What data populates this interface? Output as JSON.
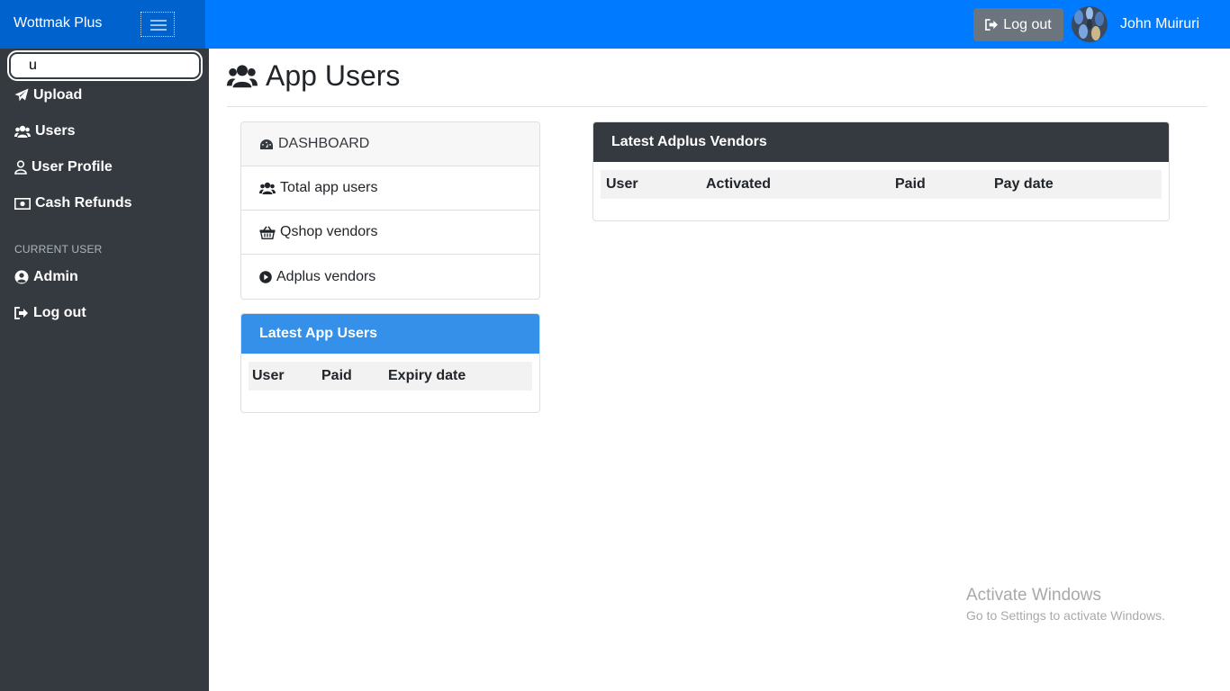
{
  "brand": {
    "name": "Wottmak Plus"
  },
  "search": {
    "value": "u"
  },
  "sidebar": {
    "items": [
      {
        "label": "Upload",
        "icon": "paper-plane-icon"
      },
      {
        "label": "Users",
        "icon": "users-icon"
      },
      {
        "label": "User Profile",
        "icon": "user-icon"
      },
      {
        "label": "Cash Refunds",
        "icon": "money-bill-icon"
      }
    ],
    "section_heading": "CURRENT USER",
    "current_user": {
      "label": "Admin",
      "icon": "user-circle-icon"
    },
    "logout": {
      "label": "Log out",
      "icon": "sign-out-icon"
    }
  },
  "navbar": {
    "logout_label": "Log out",
    "username": "John Muiruri"
  },
  "page": {
    "title": "App Users"
  },
  "menu": {
    "header": "DASHBOARD",
    "items": [
      {
        "label": "Total app users",
        "icon": "users-icon"
      },
      {
        "label": "Qshop vendors",
        "icon": "shopping-basket-icon"
      },
      {
        "label": "Adplus vendors",
        "icon": "play-circle-icon"
      }
    ]
  },
  "latest_app_users": {
    "title": "Latest App Users",
    "columns": [
      "User",
      "Paid",
      "Expiry date"
    ]
  },
  "latest_adplus_vendors": {
    "title": "Latest Adplus Vendors",
    "columns": [
      "User",
      "Activated",
      "Paid",
      "Pay date"
    ]
  },
  "watermark": {
    "line1": "Activate Windows",
    "line2": "Go to Settings to activate Windows."
  },
  "colors": {
    "primary": "#007bff",
    "brand_bar": "#0062cc",
    "sidebar": "#343a40",
    "card_users_header": "#3490e8",
    "card_vendors_header": "#343a40",
    "logout_button": "#6c757d"
  }
}
